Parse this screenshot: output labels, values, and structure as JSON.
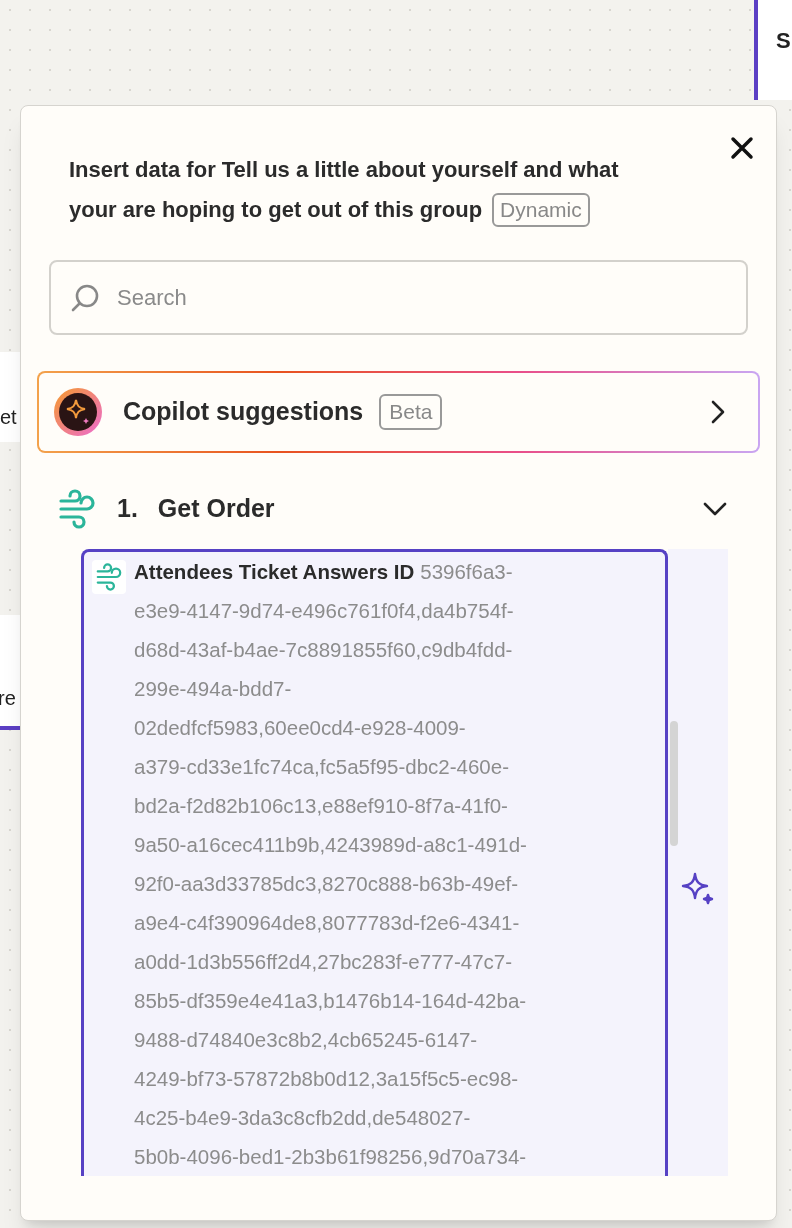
{
  "canvas": {
    "fragments": [
      {
        "kind": "top-right",
        "text": "S"
      },
      {
        "kind": "left-upper",
        "text": "et"
      },
      {
        "kind": "left-lower",
        "text": "re"
      }
    ]
  },
  "dialog": {
    "title_lines": [
      "Insert data for Tell us a little about yourself and what",
      "your are hoping to get out of this group"
    ],
    "title_badge": "Dynamic",
    "search": {
      "placeholder": "Search"
    },
    "copilot": {
      "label": "Copilot suggestions",
      "badge": "Beta"
    },
    "step": {
      "number": "1.",
      "name": "Get Order",
      "expanded": true,
      "fields": [
        {
          "label": "Attendees Ticket Answers ID",
          "selected": true,
          "value_lines": [
            "5396f6a3-",
            "e3e9-4147-9d74-e496c761f0f4,da4b754f-",
            "d68d-43af-b4ae-7c8891855f60,c9db4fdd-",
            "299e-494a-bdd7-",
            "02dedfcf5983,60ee0cd4-e928-4009-",
            "a379-cd33e1fc74ca,fc5a5f95-dbc2-460e-",
            "bd2a-f2d82b106c13,e88ef910-8f7a-41f0-",
            "9a50-a16cec411b9b,4243989d-a8c1-491d-",
            "92f0-aa3d33785dc3,8270c888-b63b-49ef-",
            "a9e4-c4f390964de8,8077783d-f2e6-4341-",
            "a0dd-1d3b556ff2d4,27bc283f-e777-47c7-",
            "85b5-df359e4e41a3,b1476b14-164d-42ba-",
            "9488-d74840e3c8b2,4cb65245-6147-",
            "4249-bf73-57872b8b0d12,3a15f5c5-ec98-",
            "4c25-b4e9-3da3c8cfb2dd,de548027-",
            "5b0b-4096-bed1-2b3b61f98256,9d70a734-"
          ]
        }
      ]
    }
  }
}
